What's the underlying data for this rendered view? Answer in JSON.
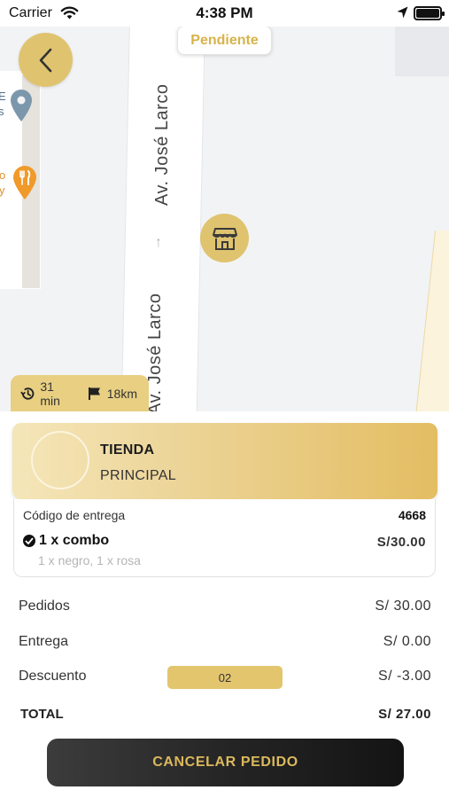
{
  "status_bar": {
    "carrier": "Carrier",
    "time": "4:38 PM"
  },
  "map": {
    "street_name_top": "Av. José Larco",
    "street_name_bottom": "Av. José Larco",
    "order_status": "Pendiente",
    "poi_gray_text": "E\ns",
    "poi_food_text": "o\ny",
    "eta": {
      "time": "31 min",
      "distance": "18km"
    }
  },
  "store": {
    "name": "TIENDA",
    "subtitle": "PRINCIPAL"
  },
  "order": {
    "code_label": "Código de entrega",
    "code_value": "4668",
    "items": [
      {
        "name": "1 x combo",
        "price": "S/30.00",
        "detail": "1 x negro, 1 x rosa"
      }
    ]
  },
  "summary": {
    "pedidos_label": "Pedidos",
    "pedidos_value": "S/ 30.00",
    "entrega_label": "Entrega",
    "entrega_value": "S/ 0.00",
    "descuento_label": "Descuento",
    "coupon_code": "02",
    "descuento_value": "S/ -3.00",
    "total_label": "TOTAL",
    "total_value": "S/ 27.00"
  },
  "actions": {
    "cancel_label": "CANCELAR PEDIDO"
  },
  "colors": {
    "accent_gold": "#dfc36f",
    "text_gold": "#d8b34a",
    "button_dark": "#232323"
  },
  "icons": [
    "back-chevron-icon",
    "store-icon",
    "history-clock-icon",
    "flag-icon",
    "map-pin-icon",
    "restaurant-icon",
    "wifi-icon",
    "location-arrow-icon",
    "battery-icon"
  ]
}
